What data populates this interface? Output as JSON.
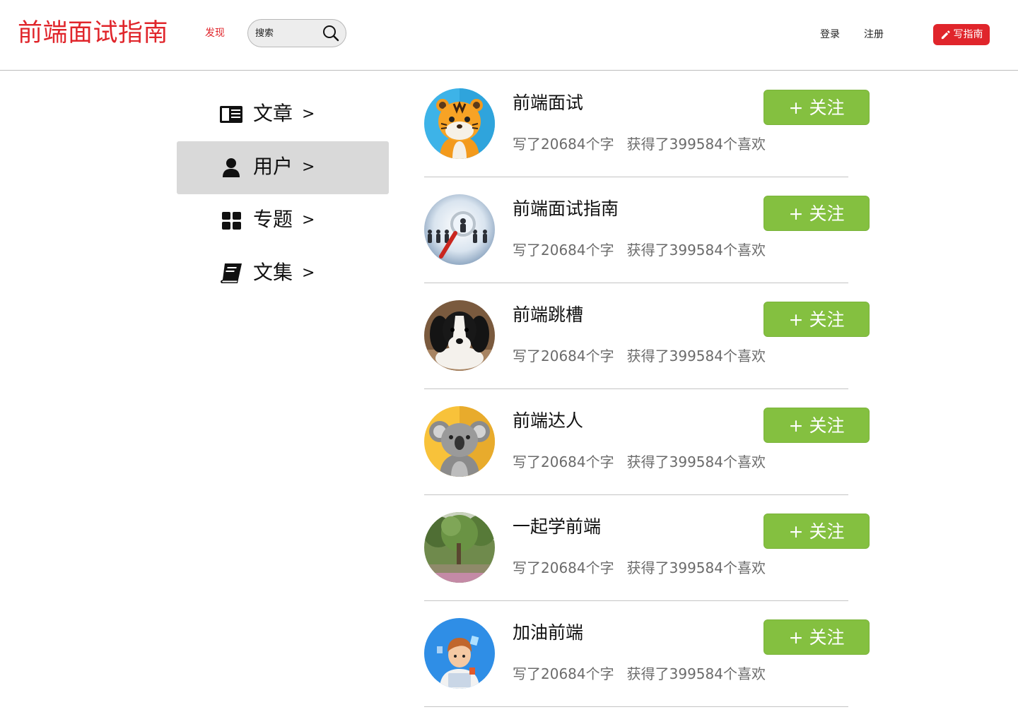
{
  "header": {
    "logo": "前端面试指南",
    "discover": "发现",
    "search_placeholder": "搜索",
    "login": "登录",
    "register": "注册",
    "write_button": "写指南",
    "accent_color": "#e0252b"
  },
  "sidebar": {
    "items": [
      {
        "label": "文章",
        "arrow": ">",
        "icon": "article-icon",
        "active": false
      },
      {
        "label": "用户",
        "arrow": ">",
        "icon": "user-icon",
        "active": true
      },
      {
        "label": "专题",
        "arrow": ">",
        "icon": "grid-icon",
        "active": false
      },
      {
        "label": "文集",
        "arrow": ">",
        "icon": "book-icon",
        "active": false
      }
    ]
  },
  "users": [
    {
      "name": "前端面试",
      "words": "写了20684个字",
      "likes": "获得了399584个喜欢",
      "follow": "+ 关注",
      "avatar": "tiger-avatar"
    },
    {
      "name": "前端面试指南",
      "words": "写了20684个字",
      "likes": "获得了399584个喜欢",
      "follow": "+ 关注",
      "avatar": "magnifier-avatar"
    },
    {
      "name": "前端跳槽",
      "words": "写了20684个字",
      "likes": "获得了399584个喜欢",
      "follow": "+ 关注",
      "avatar": "puppy-avatar"
    },
    {
      "name": "前端达人",
      "words": "写了20684个字",
      "likes": "获得了399584个喜欢",
      "follow": "+ 关注",
      "avatar": "koala-avatar"
    },
    {
      "name": "一起学前端",
      "words": "写了20684个字",
      "likes": "获得了399584个喜欢",
      "follow": "+ 关注",
      "avatar": "tree-avatar"
    },
    {
      "name": "加油前端",
      "words": "写了20684个字",
      "likes": "获得了399584个喜欢",
      "follow": "+ 关注",
      "avatar": "developer-avatar"
    }
  ],
  "colors": {
    "follow_button": "#84c040",
    "active_sidebar": "#d9d9d9",
    "stats_text": "#6b6b6b"
  }
}
